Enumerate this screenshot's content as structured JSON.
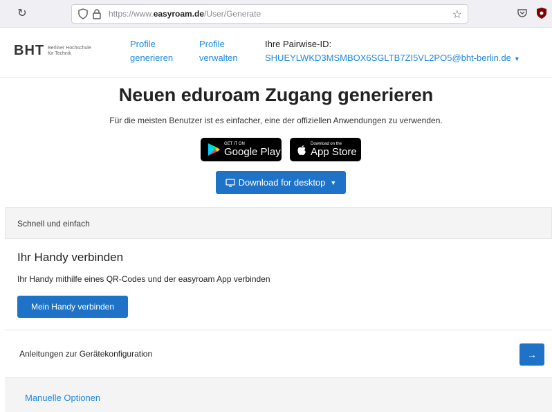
{
  "browser": {
    "url_prefix": "https://www.",
    "url_domain": "easyroam.de",
    "url_path": "/User/Generate"
  },
  "header": {
    "logo_mark": "BHT",
    "logo_sub_1": "Berliner Hochschule",
    "logo_sub_2": "für Technik",
    "nav_generate_1": "Profile",
    "nav_generate_2": "generieren",
    "nav_manage_1": "Profile",
    "nav_manage_2": "verwalten",
    "pairwise_label": "Ihre Pairwise-ID:",
    "pairwise_id": "SHUEYLWKD3MSMBOX6SGLTB7ZI5VL2PO5@bht-berlin.de"
  },
  "main": {
    "title": "Neuen eduroam Zugang generieren",
    "subtitle": "Für die meisten Benutzer ist es einfacher, eine der offiziellen Anwendungen zu verwenden.",
    "google_small": "GET IT ON",
    "google_big": "Google Play",
    "apple_small": "Download on the",
    "apple_big": "App Store",
    "desktop_download": "Download for desktop"
  },
  "quick": {
    "header": "Schnell und einfach",
    "phone_title": "Ihr Handy verbinden",
    "phone_desc": "Ihr Handy mithilfe eines QR-Codes und der easyroam App verbinden",
    "phone_button": "Mein Handy verbinden"
  },
  "guides": {
    "label": "Anleitungen zur Gerätekonfiguration",
    "arrow": "→"
  },
  "manual": {
    "label": "Manuelle Optionen"
  },
  "colors": {
    "primary": "#1e73c8",
    "link": "#1e88e5"
  }
}
